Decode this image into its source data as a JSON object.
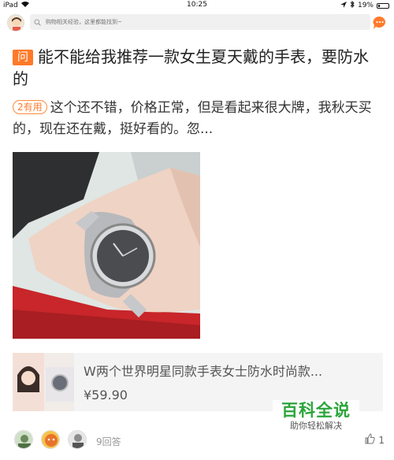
{
  "status_bar": {
    "device": "iPad",
    "time": "10:25",
    "battery": "19%",
    "battery_level": 0.19
  },
  "search": {
    "placeholder": "购物相关经验，这里都能找到~"
  },
  "question": {
    "badge": "问",
    "text": "能不能给我推荐一款女生夏天戴的手表，要防水的"
  },
  "answer": {
    "useful_badge": "2有用",
    "text": "这个还不错，价格正常，但是看起来很大牌，我秋天买的，现在还在戴，挺好看的。忽..."
  },
  "product": {
    "title": "W两个世界明星同款手表女士防水时尚款...",
    "price": "¥59.90"
  },
  "footer": {
    "answer_count": "9回答",
    "like_count": "1"
  },
  "watermark": {
    "title": "百科全说",
    "subtitle": "助你轻松解决"
  },
  "colors": {
    "accent": "#ff7a2a",
    "watermark_green": "#2aa53a"
  }
}
